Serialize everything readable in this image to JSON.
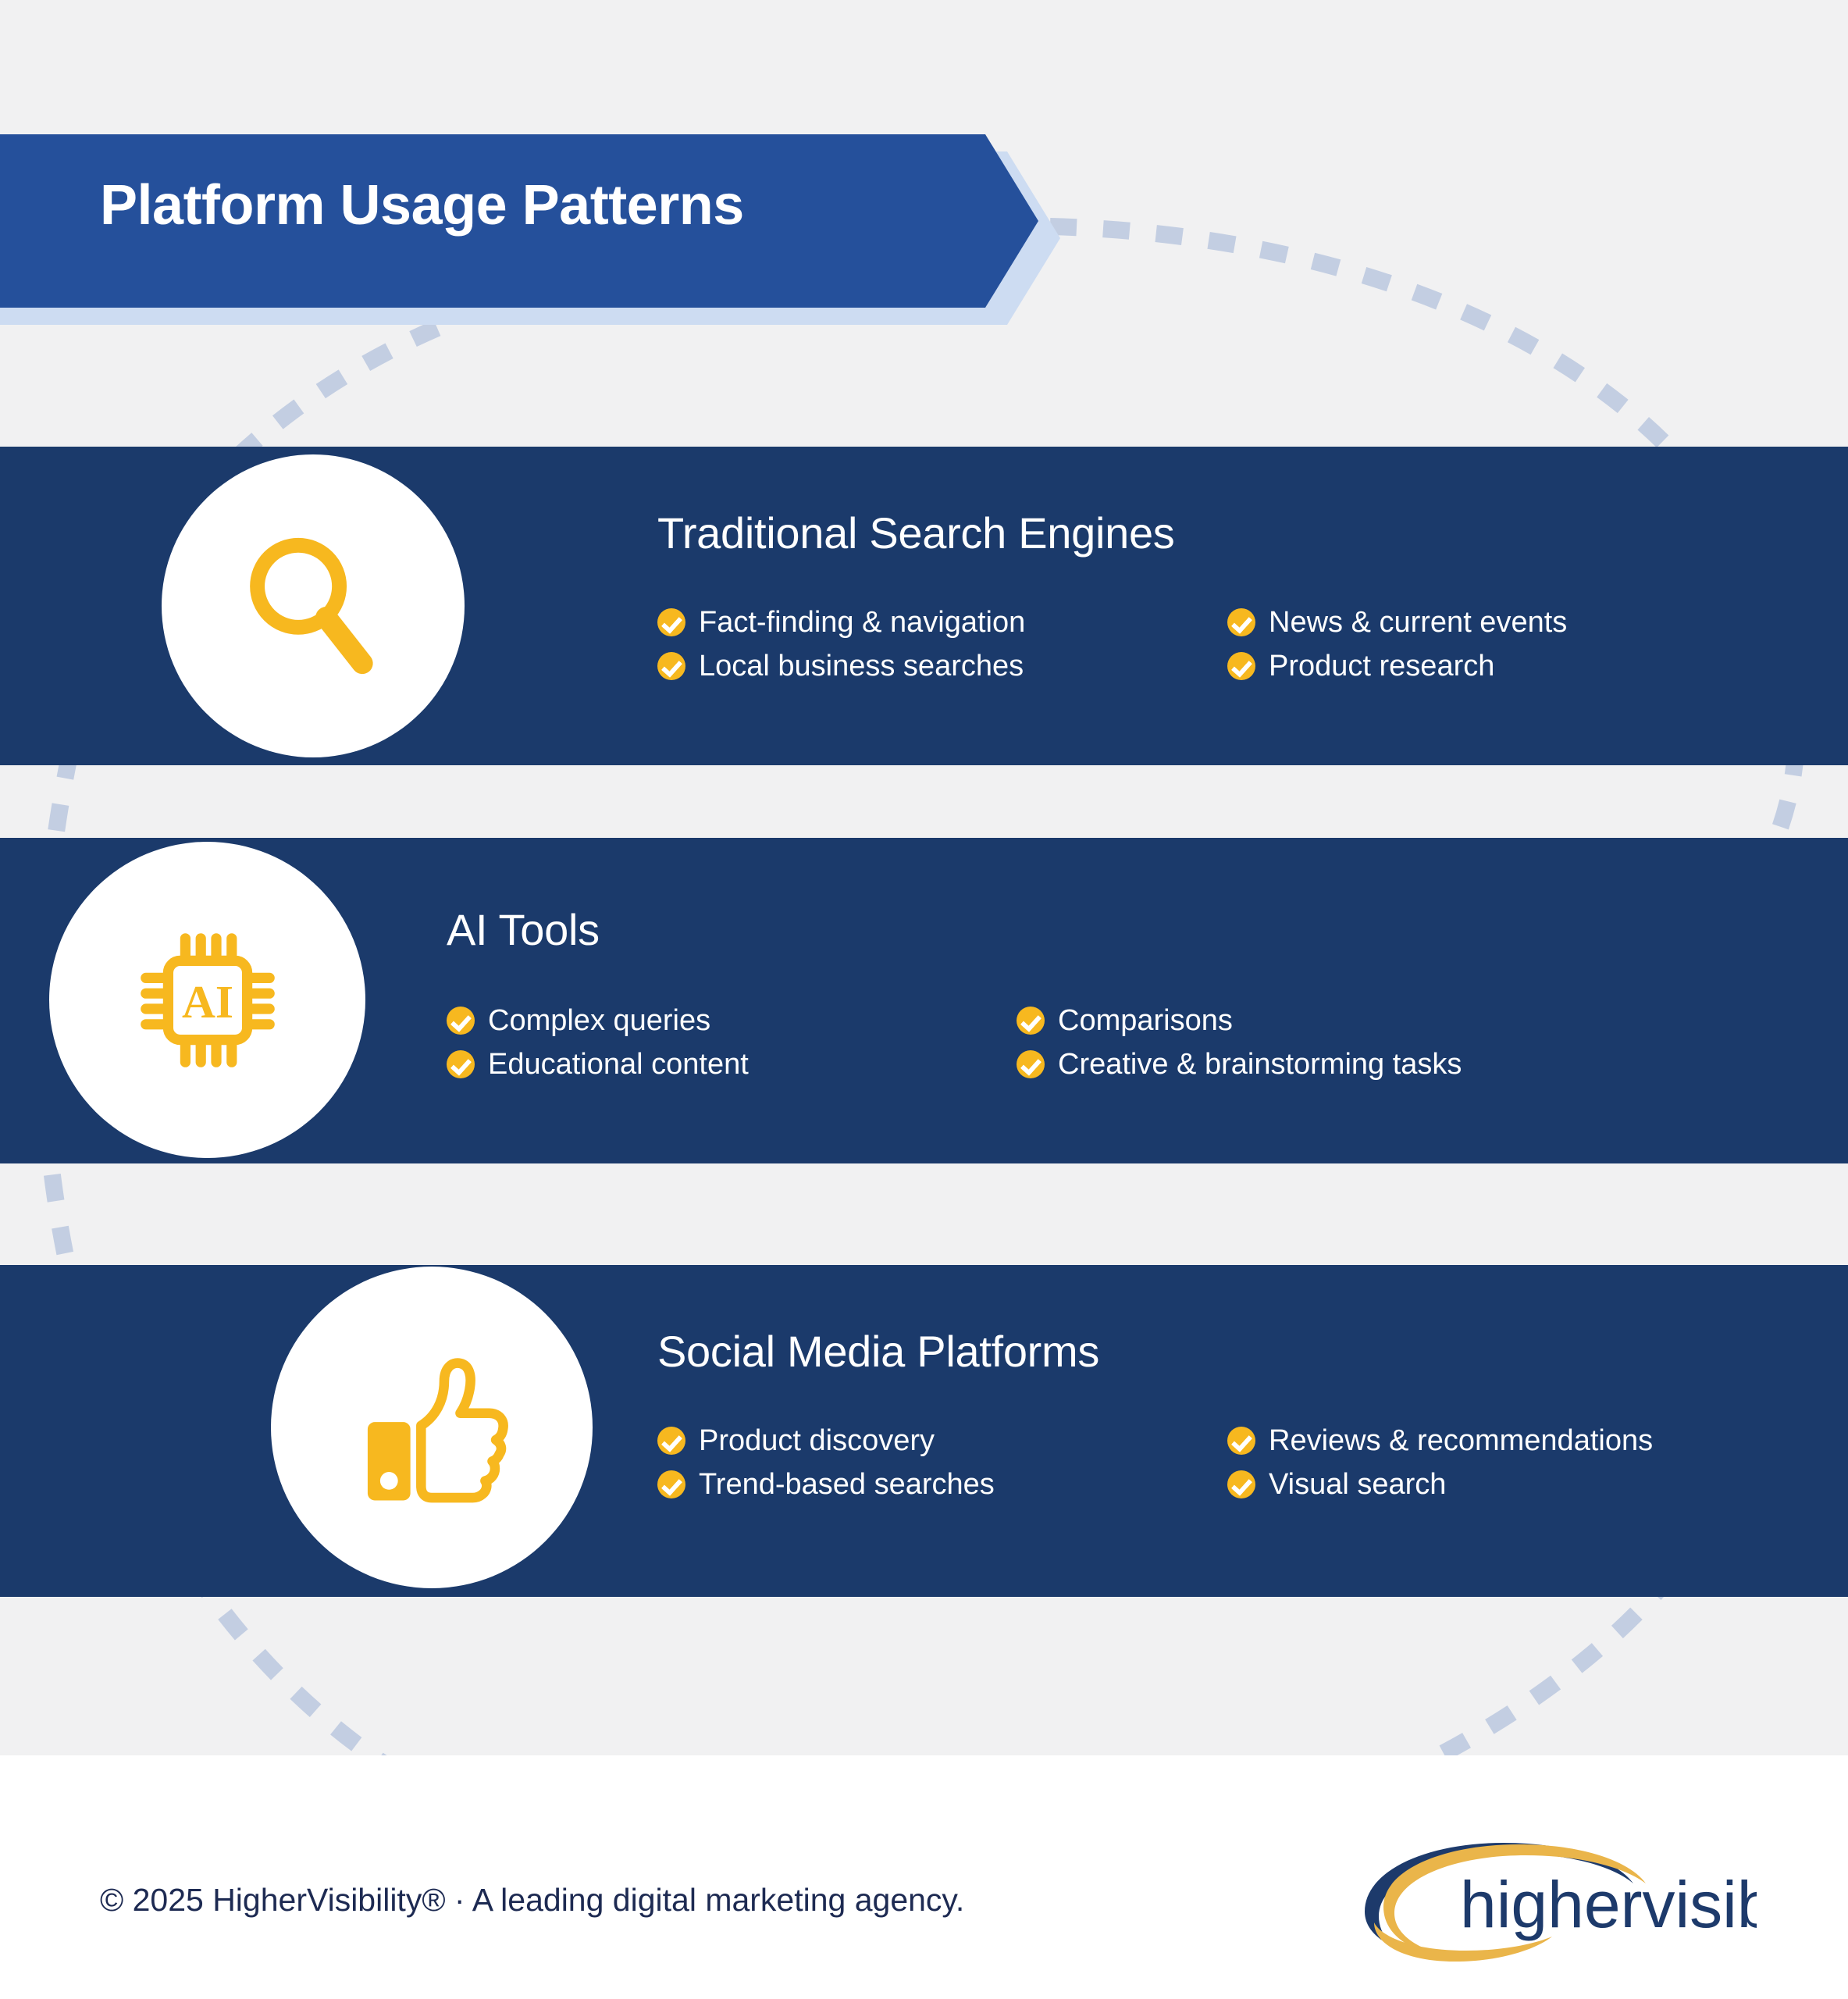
{
  "header": {
    "title": "Platform Usage Patterns",
    "banner_color": "#25509b",
    "banner_shadow_color": "#cddcf2"
  },
  "theme": {
    "background": "#f1f1f2",
    "card_blue": "#1b3a6b",
    "accent_yellow": "#f7b81f",
    "dash_color": "#c3cee2",
    "footer_text_color": "#1d2a52",
    "logo_navy": "#1d3a6b",
    "logo_gold": "#eab54a"
  },
  "cards": [
    {
      "icon": "magnifying-glass-icon",
      "title": "Traditional Search Engines",
      "bullets": [
        "Fact-finding & navigation",
        "News & current events",
        "Local business searches",
        "Product research"
      ]
    },
    {
      "icon": "ai-chip-icon",
      "title": "AI Tools",
      "bullets": [
        "Complex queries",
        "Comparisons",
        "Educational content",
        "Creative & brainstorming tasks"
      ]
    },
    {
      "icon": "thumbs-up-icon",
      "title": "Social Media Platforms",
      "bullets": [
        "Product discovery",
        "Reviews & recommendations",
        "Trend-based searches",
        "Visual search"
      ]
    }
  ],
  "footer": {
    "copyright": "© 2025 HigherVisibility® · A leading digital marketing agency.",
    "logo_text": "highervisibility"
  }
}
